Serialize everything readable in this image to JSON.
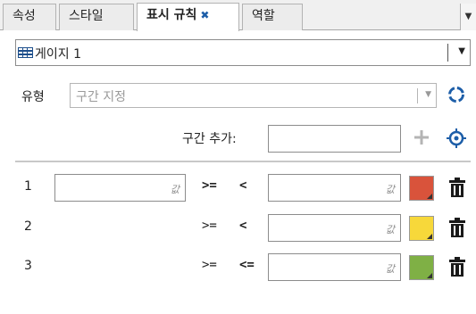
{
  "tabs": [
    {
      "label": "속성"
    },
    {
      "label": "스타일"
    },
    {
      "label": "표시 규칙",
      "close": "✖"
    },
    {
      "label": "역할"
    }
  ],
  "object_selector": {
    "value": "게이지 1",
    "icon": "gauge-grid-icon"
  },
  "type": {
    "label": "유형",
    "value": "구간 지정"
  },
  "add_range": {
    "label": "구간 추가:",
    "value": ""
  },
  "ranges": [
    {
      "index": "1",
      "min": "",
      "op1": ">=",
      "op2": "<",
      "max": "",
      "color": "#d9533b"
    },
    {
      "index": "2",
      "op1": ">=",
      "op2": "<",
      "max": "",
      "color": "#f7d83a"
    },
    {
      "index": "3",
      "op1": ">=",
      "op2": "<=",
      "max": "",
      "color": "#7fb045"
    }
  ],
  "icons": {
    "reset": "reset-icon",
    "add": "plus-icon",
    "target": "target-icon",
    "delete": "trash-icon",
    "edit": "edit-value-icon",
    "overflow": "chevron-down-icon"
  },
  "colors": {
    "accent": "#1d5ea8"
  }
}
